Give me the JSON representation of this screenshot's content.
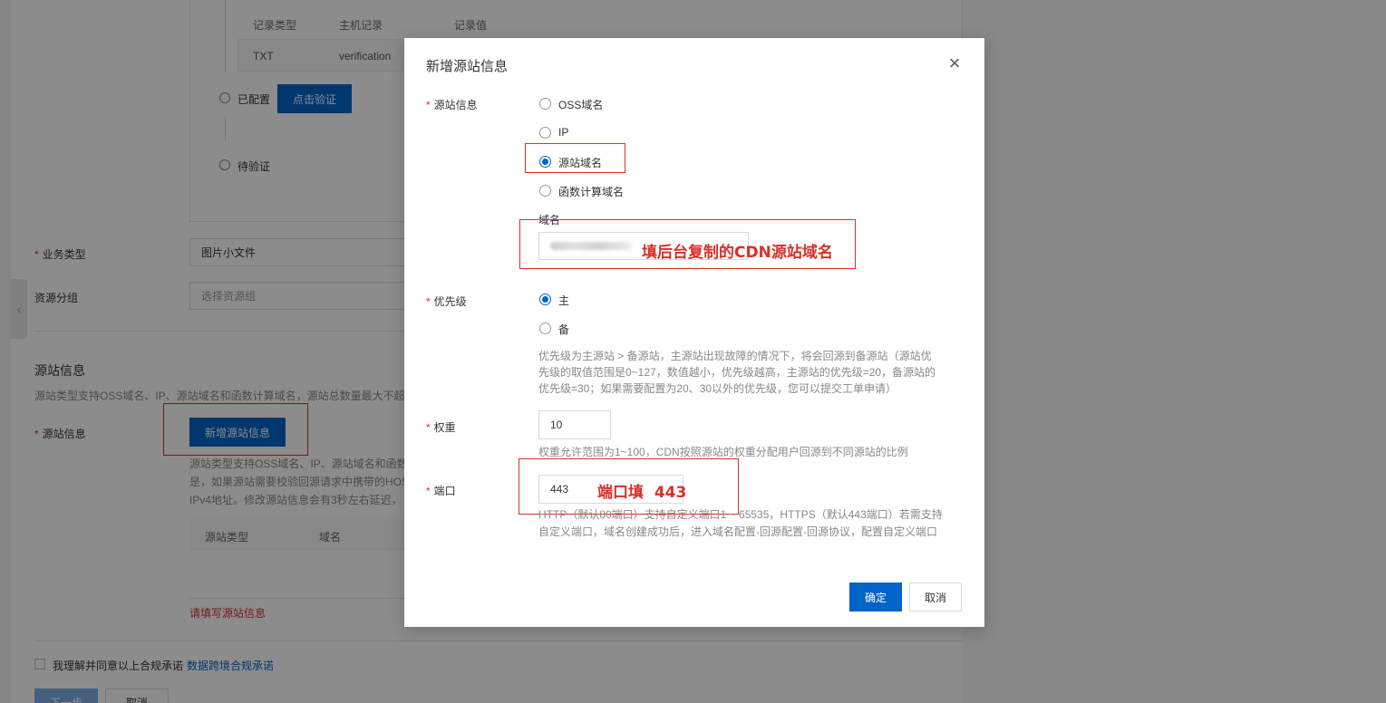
{
  "background": {
    "table_headers": [
      "记录类型",
      "主机记录",
      "记录值"
    ],
    "txt_row": {
      "type": "TXT",
      "host": "verification"
    },
    "steps": [
      {
        "label": "已配置",
        "button": "点击验证"
      },
      {
        "label": "待验证"
      }
    ],
    "business_type": {
      "label": "业务类型",
      "value": "图片小文件"
    },
    "resource_group": {
      "label": "资源分组",
      "placeholder": "选择资源组"
    },
    "origin_section": {
      "title": "源站信息",
      "desc": "源站类型支持OSS域名、IP、源站域名和函数计算域名，源站总数量最大不超过",
      "field_label": "源站信息",
      "add_button": "新增源站信息",
      "desc2_line1": "源站类型支持OSS域名、IP、源站域名和函数",
      "desc2_line2": "是，如果源站需要校验回源请求中携带的HOS",
      "desc2_line3": "IPv4地址。修改源站信息会有3秒左右延迟，",
      "table_headers": [
        "源站类型",
        "域名"
      ],
      "error": "请填写源站信息"
    },
    "agreement": {
      "text": "我理解并同意以上合规承诺",
      "link": "数据跨境合规承诺"
    },
    "footer_buttons": [
      "下一步",
      "取消"
    ]
  },
  "modal": {
    "title": "新增源站信息",
    "origin_label": "源站信息",
    "origin_options": [
      "OSS域名",
      "IP",
      "源站域名",
      "函数计算域名"
    ],
    "origin_selected_index": 2,
    "domain_label": "域名",
    "domain_annotation": "填后台复制的CDN源站域名",
    "priority_label": "优先级",
    "priority_options": [
      "主",
      "备"
    ],
    "priority_selected_index": 0,
    "priority_help": {
      "line1": "优先级为主源站 > 备源站，主源站出现故障的情况下，将会回源到备源站（源站优",
      "line2": "先级的取值范围是0~127，数值越小，优先级越高，主源站的优先级=20，备源站的",
      "line3": "优先级=30；如果需要配置为20、30以外的优先级，您可以提交工单申请）"
    },
    "weight_label": "权重",
    "weight_value": "10",
    "weight_help": "权重允许范围为1~100，CDN按照源站的权重分配用户回源到不同源站的比例",
    "port_label": "端口",
    "port_value": "443",
    "port_annotation": "端口填  443",
    "port_help": {
      "line1": "HTTP（默认80端口）支持自定义端口1 ~ 65535，HTTPS（默认443端口）若需支持",
      "line2": "自定义端口，域名创建成功后，进入域名配置-回源配置-回源协议，配置自定义端口"
    },
    "confirm": "确定",
    "cancel": "取消"
  },
  "colors": {
    "primary": "#0064c8",
    "annotation": "#d93026",
    "required": "#d93026"
  }
}
